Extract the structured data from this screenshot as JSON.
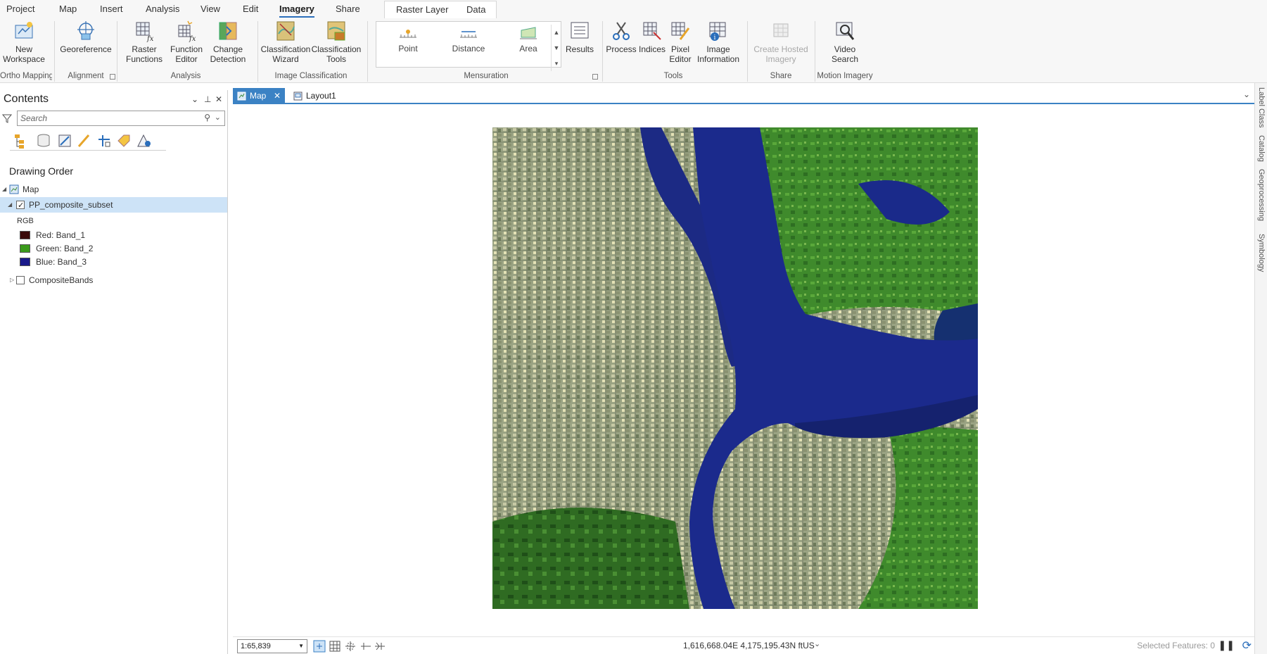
{
  "ribbon_tabs": [
    "Project",
    "Map",
    "Insert",
    "Analysis",
    "View",
    "Edit",
    "Imagery",
    "Share"
  ],
  "active_tab": "Imagery",
  "context_tabs": [
    "Raster Layer",
    "Data"
  ],
  "ribbon": {
    "new_workspace": "New Workspace",
    "georeference": "Georeference",
    "raster_functions": "Raster Functions",
    "function_editor": "Function Editor",
    "change_detection": "Change Detection",
    "classification_wizard": "Classification Wizard",
    "classification_tools": "Classification Tools",
    "mensuration_point": "Point",
    "mensuration_distance": "Distance",
    "mensuration_area": "Area",
    "results": "Results",
    "process": "Process",
    "indices": "Indices",
    "pixel_editor": "Pixel Editor",
    "image_information": "Image Information",
    "create_hosted_imagery": "Create Hosted Imagery",
    "video_search": "Video Search"
  },
  "ribbon_groups": {
    "ortho_mapping": "Ortho Mapping",
    "alignment": "Alignment",
    "analysis": "Analysis",
    "image_classification": "Image Classification",
    "mensuration": "Mensuration",
    "tools": "Tools",
    "share": "Share",
    "motion_imagery": "Motion Imagery"
  },
  "contents": {
    "title": "Contents",
    "search_placeholder": "Search",
    "section": "Drawing Order",
    "map_label": "Map",
    "layer_name": "PP_composite_subset",
    "renderer": "RGB",
    "bands": [
      {
        "label": "Red:  Band_1",
        "color": "#3a0a0a"
      },
      {
        "label": "Green: Band_2",
        "color": "#3a9a1a"
      },
      {
        "label": "Blue:  Band_3",
        "color": "#1a1a8a"
      }
    ],
    "other_layer": "CompositeBands"
  },
  "doc_tabs": [
    "Map",
    "Layout1"
  ],
  "status": {
    "scale": "1:65,839",
    "coordinates": "1,616,668.04E 4,175,195.43N ftUS",
    "selected_features": "Selected Features: 0"
  },
  "right_dock": [
    "Label Class",
    "Catalog",
    "Geoprocessing",
    "Symbology"
  ]
}
